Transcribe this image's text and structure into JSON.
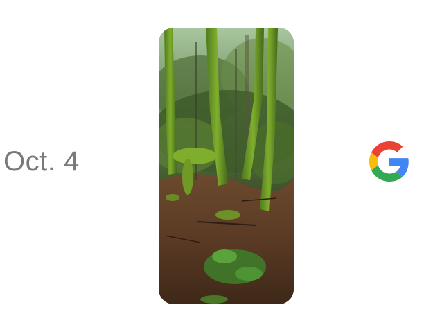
{
  "announcement": {
    "date_text": "Oct. 4"
  },
  "phone": {
    "screen_image": "forest-with-moss-covered-trees",
    "icon": "smartphone-silhouette"
  },
  "brand": {
    "logo": "google-g-logo",
    "colors": {
      "blue": "#4285F4",
      "red": "#EA4335",
      "yellow": "#FBBC05",
      "green": "#34A853"
    }
  },
  "colors": {
    "background": "#ffffff",
    "date_text": "#7a7a7a"
  }
}
